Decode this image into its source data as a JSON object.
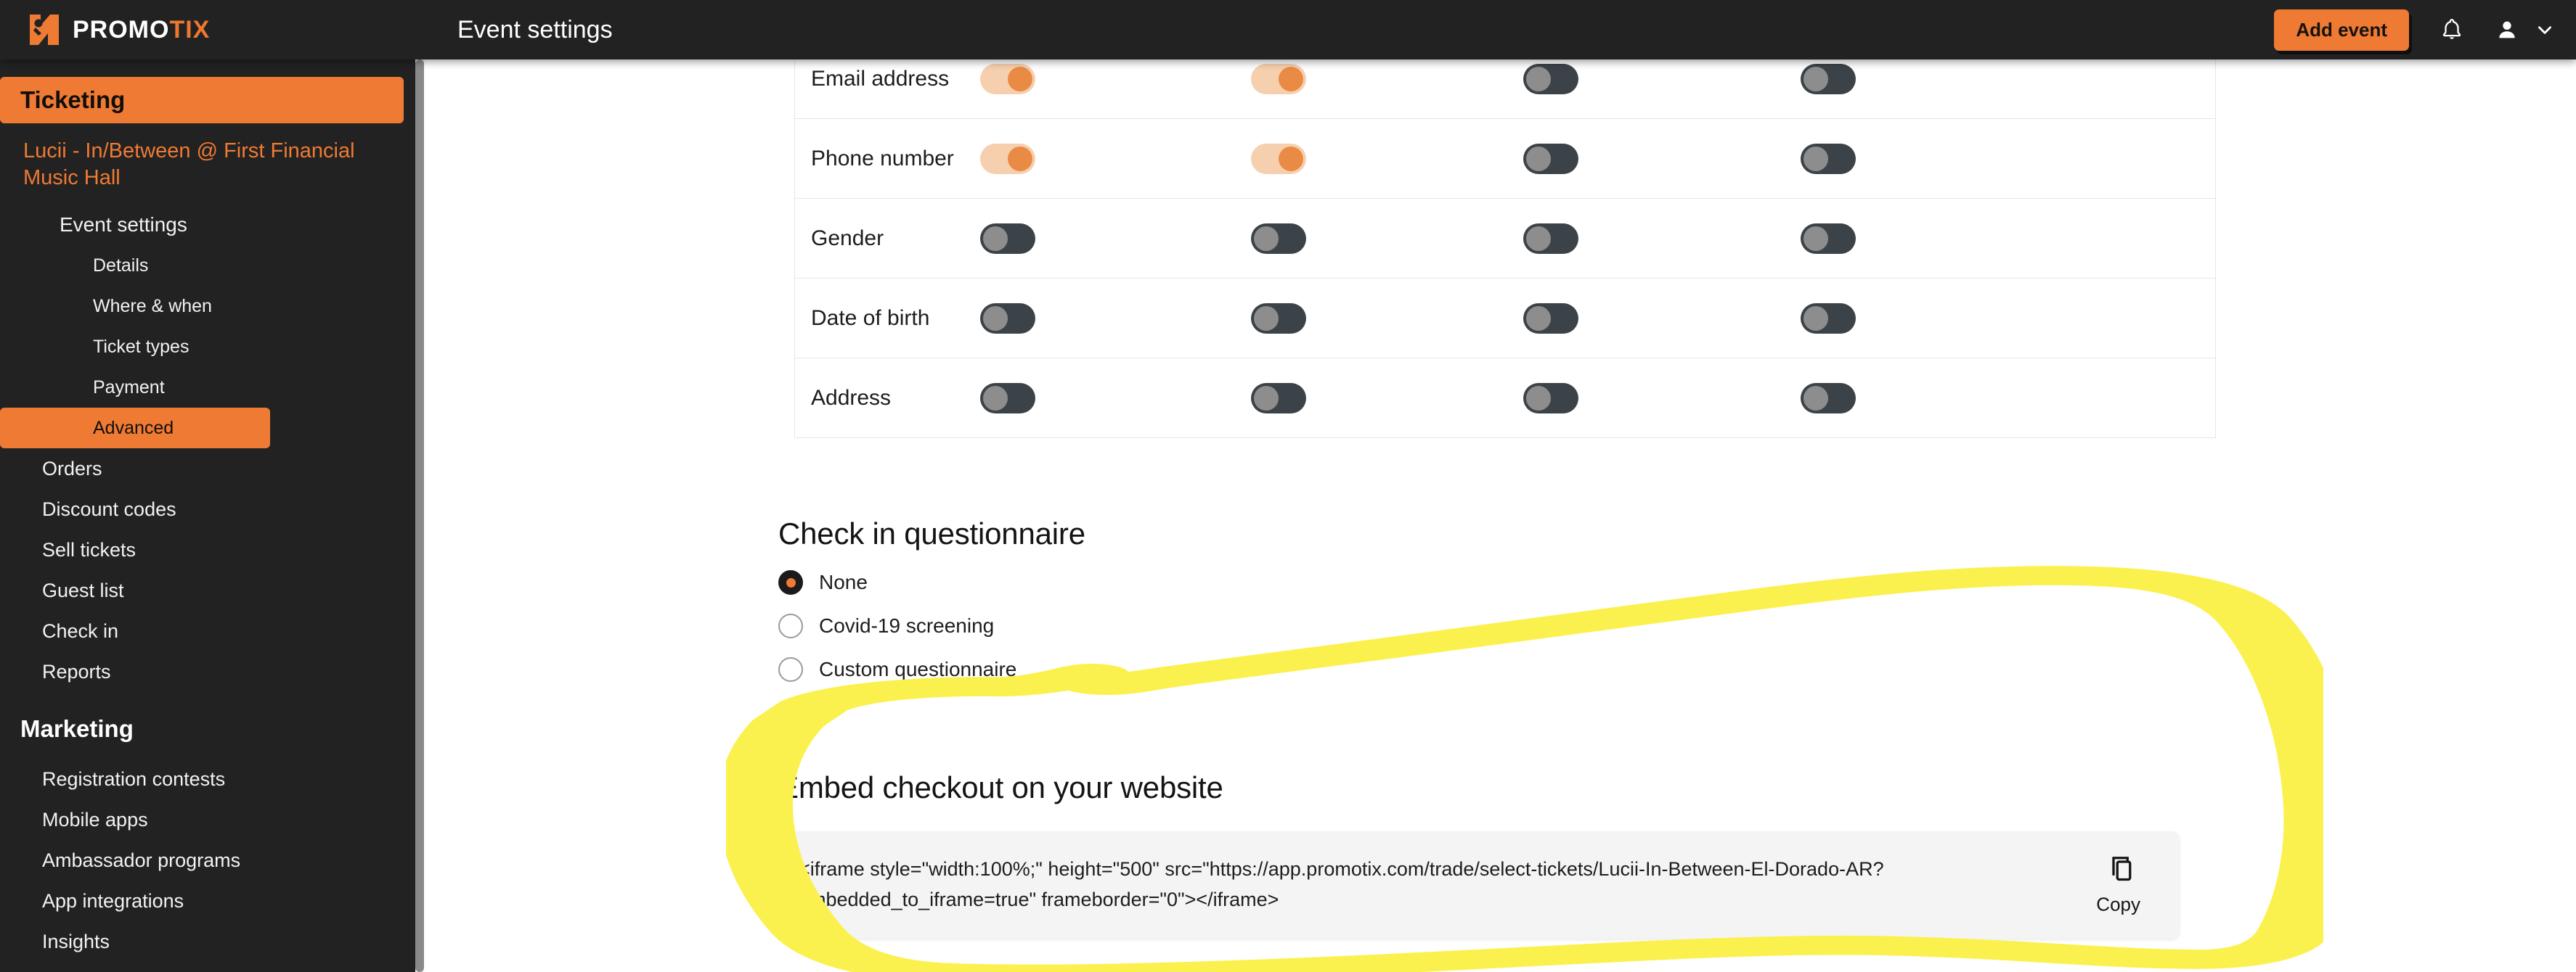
{
  "brand": {
    "name_dark": "PROMO",
    "name_accent": "TIX",
    "logo_icon": "promotix-logo-icon"
  },
  "header": {
    "title": "Event settings",
    "add_event_label": "Add event",
    "bell_icon": "bell-icon",
    "avatar_icon": "user-icon",
    "caret_icon": "chevron-down-icon",
    "accent_color": "#ef7a33",
    "background_color": "#222222"
  },
  "sidebar": {
    "section_ticketing": "Ticketing",
    "event_name": "Lucii - In/Between @ First Financial Music Hall",
    "event_settings_label": "Event settings",
    "event_settings_children": [
      {
        "label": "Details",
        "active": false
      },
      {
        "label": "Where & when",
        "active": false
      },
      {
        "label": "Ticket types",
        "active": false
      },
      {
        "label": "Payment",
        "active": false
      },
      {
        "label": "Advanced",
        "active": true
      }
    ],
    "ticketing_items": [
      {
        "label": "Orders"
      },
      {
        "label": "Discount codes"
      },
      {
        "label": "Sell tickets"
      },
      {
        "label": "Guest list"
      },
      {
        "label": "Check in"
      },
      {
        "label": "Reports"
      }
    ],
    "section_marketing": "Marketing",
    "marketing_items": [
      {
        "label": "Registration contests"
      },
      {
        "label": "Mobile apps"
      },
      {
        "label": "Ambassador programs"
      },
      {
        "label": "App integrations"
      },
      {
        "label": "Insights"
      }
    ]
  },
  "preferences_table": {
    "rows": [
      {
        "label": "Email address",
        "toggles": [
          "on",
          "on",
          "off",
          "off"
        ]
      },
      {
        "label": "Phone number",
        "toggles": [
          "on",
          "on",
          "off",
          "off"
        ]
      },
      {
        "label": "Gender",
        "toggles": [
          "off",
          "off",
          "off",
          "off"
        ]
      },
      {
        "label": "Date of birth",
        "toggles": [
          "off",
          "off",
          "off",
          "off"
        ]
      },
      {
        "label": "Address",
        "toggles": [
          "off",
          "off",
          "off",
          "off"
        ]
      }
    ],
    "toggle_on_color": "#f6cfae",
    "toggle_on_knob_color": "#e98b45",
    "toggle_off_color": "#3c4348",
    "toggle_off_knob_color": "#8d8d8d"
  },
  "questionnaire": {
    "title": "Check in questionnaire",
    "options": [
      {
        "label": "None",
        "selected": true
      },
      {
        "label": "Covid-19 screening",
        "selected": false
      },
      {
        "label": "Custom questionnaire",
        "selected": false
      }
    ]
  },
  "embed": {
    "title": "Embed checkout on your website",
    "code": "<iframe style=\"width:100%;\" height=\"500\" src=\"https://app.promotix.com/trade/select-tickets/Lucii-In-Between-El-Dorado-AR?embedded_to_iframe=true\" frameborder=\"0\"></iframe>",
    "copy_label": "Copy",
    "copy_icon": "copy-icon"
  },
  "annotation": {
    "type": "freehand-highlight-ellipse",
    "color": "#fbf14e"
  }
}
